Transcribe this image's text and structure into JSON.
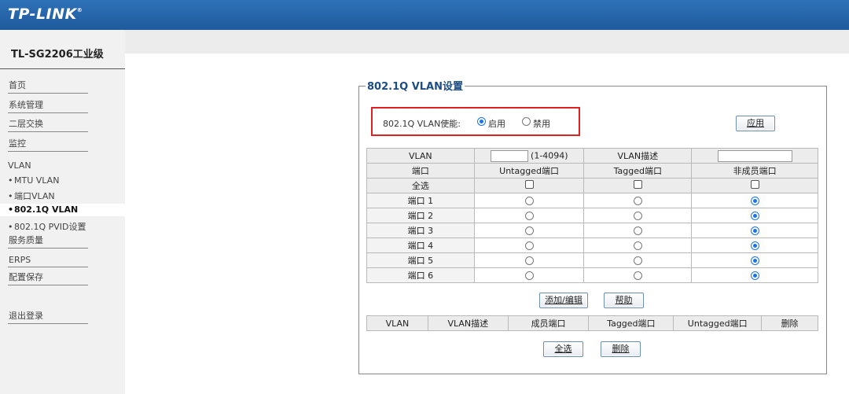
{
  "header": {
    "logo": "TP-LINK",
    "logo_mark": "®"
  },
  "sidebar": {
    "model": "TL-SG2206工业级",
    "items": [
      {
        "label": "首页"
      },
      {
        "label": "系统管理"
      },
      {
        "label": "二层交换"
      },
      {
        "label": "监控"
      }
    ],
    "vlan_group": "VLAN",
    "vlan_sub": [
      {
        "label": "MTU VLAN"
      },
      {
        "label": "端口VLAN"
      },
      {
        "label": "802.1Q VLAN",
        "active": true
      },
      {
        "label": "802.1Q PVID设置"
      }
    ],
    "items2": [
      {
        "label": "服务质量"
      },
      {
        "label": "ERPS"
      },
      {
        "label": "配置保存"
      }
    ],
    "logout": "退出登录"
  },
  "panel": {
    "title": "802.1Q VLAN设置",
    "enable_label": "802.1Q VLAN使能:",
    "enable_opt": "启用",
    "disable_opt": "禁用",
    "enabled": true,
    "apply_label": "应用"
  },
  "config_table": {
    "vlan_label": "VLAN",
    "vlan_range": "(1-4094)",
    "vlan_id_value": "",
    "vlan_desc_label": "VLAN描述",
    "vlan_desc_value": "",
    "headers": [
      "端口",
      "Untagged端口",
      "Tagged端口",
      "非成员端口"
    ],
    "select_all": "全选",
    "ports": [
      {
        "name": "端口 1",
        "mode": "non-member"
      },
      {
        "name": "端口 2",
        "mode": "non-member"
      },
      {
        "name": "端口 3",
        "mode": "non-member"
      },
      {
        "name": "端口 4",
        "mode": "non-member"
      },
      {
        "name": "端口 5",
        "mode": "non-member"
      },
      {
        "name": "端口 6",
        "mode": "non-member"
      }
    ]
  },
  "buttons": {
    "add_edit": "添加/编辑",
    "help": "帮助",
    "select_all": "全选",
    "delete": "删除"
  },
  "list_table": {
    "headers": [
      "VLAN",
      "VLAN描述",
      "成员端口",
      "Tagged端口",
      "Untagged端口",
      "删除"
    ]
  }
}
